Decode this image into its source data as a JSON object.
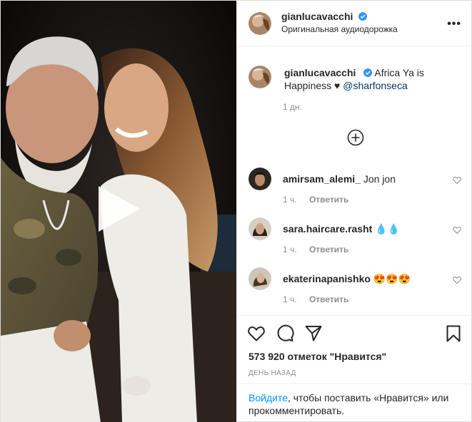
{
  "post": {
    "author": {
      "username": "gianlucavacchi",
      "verified_icon": "verified-badge-icon",
      "subtitle": "Оригинальная аудиодорожка"
    },
    "more_icon": "more-options-icon",
    "more_label": "•••",
    "caption": {
      "username": "gianlucavacchi",
      "text": "Africa Ya is Happiness",
      "emoji": "♥",
      "mention": "@sharfonseca",
      "time": "1 дн."
    },
    "load_more_icon": "plus-circle-icon",
    "comments": [
      {
        "username": "amirsam_alemi_",
        "text": "Jon jon",
        "time": "1 ч.",
        "reply": "Ответить"
      },
      {
        "username": "sara.haircare.rasht",
        "text": "💧💧",
        "time": "1 ч.",
        "reply": "Ответить"
      },
      {
        "username": "ekaterinapanishko",
        "text": "😍😍😍",
        "time": "1 ч.",
        "reply": "Ответить"
      }
    ],
    "actions": {
      "like_icon": "heart-outline-icon",
      "comment_icon": "comment-icon",
      "share_icon": "paper-plane-icon",
      "save_icon": "bookmark-icon"
    },
    "likes": "573 920 отметок \"Нравится\"",
    "date": "ДЕНЬ НАЗАД",
    "login": {
      "link": "Войдите",
      "text": ", чтобы поставить «Нравится» или прокомментировать."
    },
    "play_icon": "play-icon"
  }
}
